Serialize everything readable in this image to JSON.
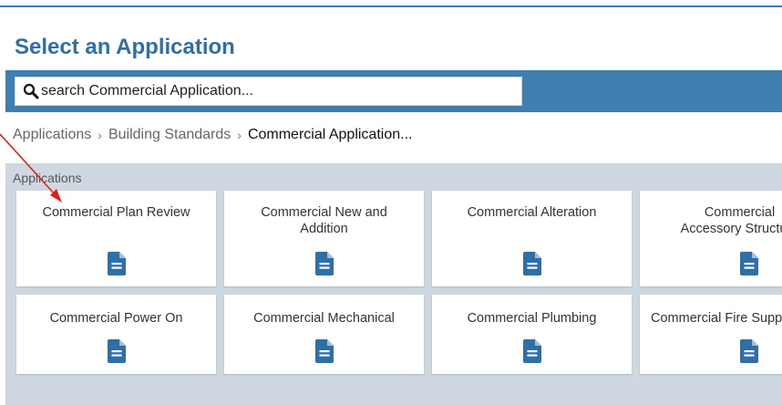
{
  "header": {
    "title": "Select an Application"
  },
  "search": {
    "placeholder": "search Commercial Application..."
  },
  "breadcrumb": {
    "items": [
      "Applications",
      "Building Standards",
      "Commercial Application..."
    ]
  },
  "apps": {
    "section_label": "Applications",
    "cards": [
      {
        "title": "Commercial Plan Review",
        "icon": "document-icon"
      },
      {
        "title": "Commercial New and Addition",
        "icon": "document-icon"
      },
      {
        "title": "Commercial Alteration",
        "icon": "document-icon"
      },
      {
        "title": "Commercial Accessory Structure",
        "icon": "document-icon"
      },
      {
        "title": "Commercial Power On",
        "icon": "document-icon"
      },
      {
        "title": "Commercial Mechanical",
        "icon": "document-icon"
      },
      {
        "title": "Commercial Plumbing",
        "icon": "document-icon"
      },
      {
        "title": "Commercial Fire Suppression",
        "icon": "document-icon"
      }
    ]
  },
  "colors": {
    "accent": "#3f7fb0",
    "title": "#2f6fa6",
    "panel": "#cfd8e0",
    "icon": "#2f6fa6",
    "arrow": "#e0201a"
  }
}
